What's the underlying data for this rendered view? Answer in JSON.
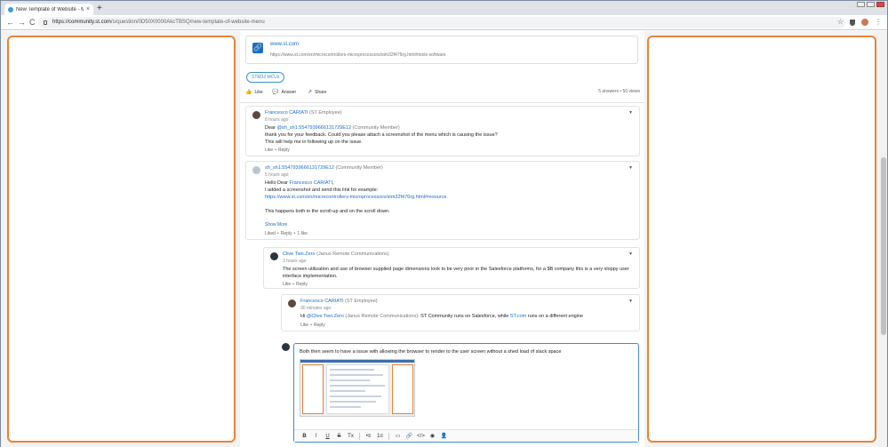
{
  "browser": {
    "tab_title": "New Template of Website - Men",
    "tab_close": "×",
    "new_tab": "+",
    "url_domain": "https://community.st.com",
    "url_path": "/s/question/0D50X0000AkcTBSQ/new-template-of-website-menu",
    "back": "←",
    "forward": "→",
    "reload": "C"
  },
  "link_card": {
    "title": "www.st.com",
    "url": "https://www.st.com/en/microcontrollers-microprocessors/stm32f476rg.html#tools-software"
  },
  "topic_tag": "STM32 MCUs",
  "actions": {
    "like": "Like",
    "answer": "Answer",
    "share": "Share",
    "stats": "5 answers • 50 views"
  },
  "comments": [
    {
      "author": "Francesco CARIATI",
      "role": "(ST Employee)",
      "time": "8 hours ago",
      "line1_pre": "Dear ",
      "line1_link": "@sh_sh1.5547939666131729E12",
      "line1_role": " (Community Member)",
      "line2": "thank you for your feedback. Could you please attach a screenshot of the menu which is causing the issue?",
      "line3": "This will help me in following up on the issue.",
      "foot_like": "Like",
      "foot_reply": "Reply"
    },
    {
      "author": "sh_sh1.5547939666131729E12",
      "role": "(Community Member)",
      "time": "5 hours ago",
      "line1_pre": "Hello Dear ",
      "line1_link": "Francesco CARIATI",
      "line1_post": ",",
      "line2": "I added a screenshot and send this link for example:",
      "line3": "https://www.st.com/en/microcontrollers-microprocessors/stm32f476rg.html#resource",
      "line4": "This happens both in the scroll-up and on the scroll down.",
      "show_more": "Show More",
      "foot_liked": "Liked",
      "foot_reply": "Reply",
      "foot_likes": "1 like"
    },
    {
      "author": "Clive Two.Zero",
      "role": "(Janus Remote Communications)",
      "time": "3 hours ago",
      "line1": "The screen utilization and use of browser supplied page dimensions look to be very poor in the Salesforce platforms, for a $B company this is a very sloppy user",
      "line2": "interface implementation.",
      "foot_like": "Like",
      "foot_reply": "Reply"
    },
    {
      "author": "Francesco CARIATI",
      "role": "(ST Employee)",
      "time": "30 minutes ago",
      "line1_pre": "Hi ",
      "line1_link": "@Clive Two.Zero",
      "line1_role": " (Janus Remote Communications)",
      "line1_mid": ": ST Community runs on Salesforce, while ",
      "line1_link2": "ST.com",
      "line1_post": " runs on a different engine",
      "foot_like": "Like",
      "foot_reply": "Reply"
    }
  ],
  "editor": {
    "text": "Both then seem to have a issue with allowing the browser to render to the user screen without a shed load of slack space",
    "toolbar": [
      "B",
      "I",
      "U",
      "S",
      "Tx",
      "•≡",
      "1≡",
      "▭",
      "🔗",
      "</>",
      "◉",
      "👤"
    ]
  },
  "colors": {
    "highlight": "#e8833a",
    "link": "#1b6cc9",
    "focus": "#3a8fd1"
  }
}
